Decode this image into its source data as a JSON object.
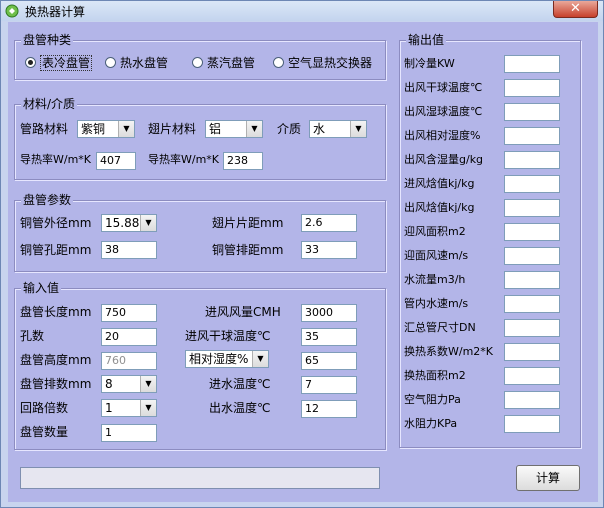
{
  "window": {
    "title": "换热器计算",
    "close_glyph": "✕"
  },
  "coil_type": {
    "legend": "盘管种类",
    "options": [
      {
        "label": "表冷盘管",
        "selected": true
      },
      {
        "label": "热水盘管",
        "selected": false
      },
      {
        "label": "蒸汽盘管",
        "selected": false
      },
      {
        "label": "空气显热交换器",
        "selected": false
      }
    ]
  },
  "material": {
    "legend": "材料/介质",
    "pipe_label": "管路材料",
    "pipe_value": "紫铜",
    "fin_label": "翅片材料",
    "fin_value": "铝",
    "medium_label": "介质",
    "medium_value": "水",
    "pipe_k_label": "导热率W/m*K",
    "pipe_k_value": "407",
    "fin_k_label": "导热率W/m*K",
    "fin_k_value": "238"
  },
  "coil_params": {
    "legend": "盘管参数",
    "od_label": "铜管外径mm",
    "od_value": "15.88",
    "fin_pitch_label": "翅片片距mm",
    "fin_pitch_value": "2.6",
    "hole_pitch_label": "铜管孔距mm",
    "hole_pitch_value": "38",
    "row_pitch_label": "铜管排距mm",
    "row_pitch_value": "33"
  },
  "inputs": {
    "legend": "输入值",
    "length_label": "盘管长度mm",
    "length_value": "750",
    "holes_label": "孔数",
    "holes_value": "20",
    "height_label": "盘管高度mm",
    "height_value": "760",
    "rows_label": "盘管排数mm",
    "rows_value": "8",
    "circuit_label": "回路倍数",
    "circuit_value": "1",
    "count_label": "盘管数量",
    "count_value": "1",
    "airflow_label": "进风风量CMH",
    "airflow_value": "3000",
    "dry_bulb_label": "进风干球温度℃",
    "dry_bulb_value": "35",
    "humidity_select": "相对湿度%",
    "humidity_value": "65",
    "water_in_label": "进水温度℃",
    "water_in_value": "7",
    "water_out_label": "出水温度℃",
    "water_out_value": "12"
  },
  "outputs": {
    "legend": "输出值",
    "items": [
      "制冷量KW",
      "出风干球温度℃",
      "出风湿球温度℃",
      "出风相对湿度%",
      "出风含湿量g/kg",
      "进风焓值kj/kg",
      "出风焓值kj/kg",
      "迎风面积m2",
      "迎面风速m/s",
      "水流量m3/h",
      "管内水速m/s",
      "汇总管尺寸DN",
      "换热系数W/m2*K",
      "换热面积m2",
      "空气阻力Pa",
      "水阻力KPa"
    ]
  },
  "calc_button": "计算"
}
